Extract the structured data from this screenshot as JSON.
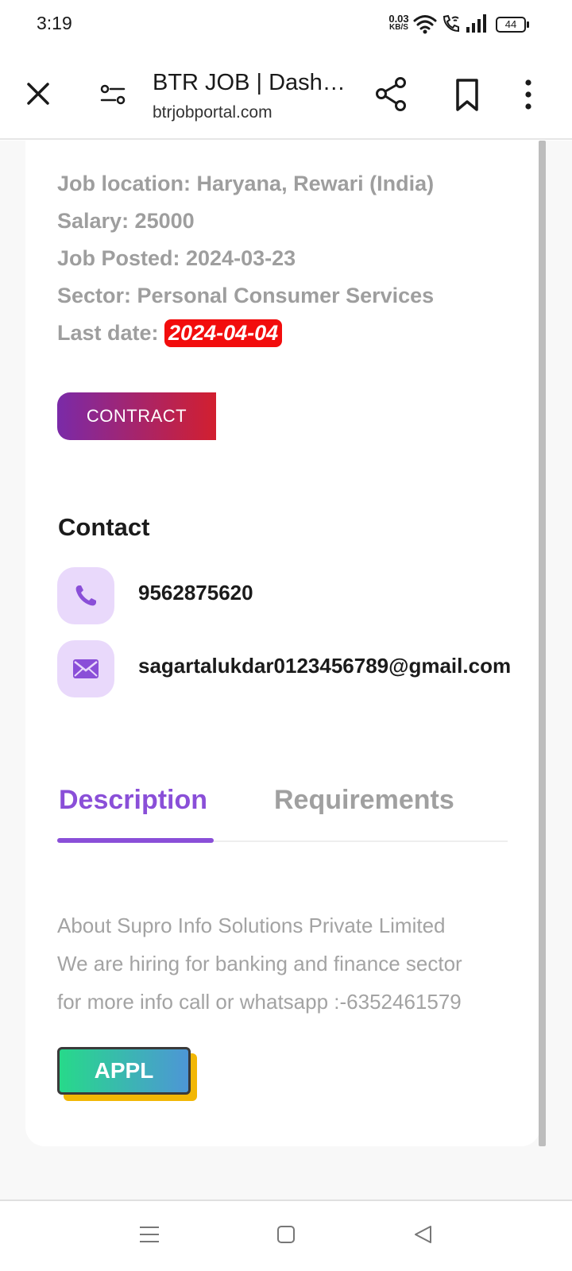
{
  "status_bar": {
    "time": "3:19",
    "net_speed_value": "0.03",
    "net_speed_unit": "KB/S",
    "battery": "44"
  },
  "browser": {
    "title": "BTR JOB | Dash…",
    "url": "btrjobportal.com"
  },
  "job": {
    "location_label": "Job location: Haryana, Rewari (India)",
    "salary_label": "Salary: 25000",
    "posted_label": "Job Posted: 2024-03-23",
    "sector_label": "Sector: Personal Consumer Services",
    "last_date_label": "Last date: ",
    "last_date_value": "2024-04-04",
    "type_badge": "CONTRACT"
  },
  "contact": {
    "title": "Contact",
    "phone": "9562875620",
    "email": "sagartalukdar0123456789@gmail.com"
  },
  "tabs": [
    {
      "label": "Description",
      "active": true
    },
    {
      "label": "Requirements",
      "active": false
    }
  ],
  "description": {
    "lines": [
      "About Supro Info Solutions Private Limited",
      "We are hiring for banking and finance sector",
      "for more info call or whatsapp :-6352461579"
    ]
  },
  "apply_button": "APPL",
  "colors": {
    "accent_purple": "#8a4fd8",
    "last_date_bg": "#f20d0d",
    "contact_icon_bg": "#e9d9fb"
  }
}
